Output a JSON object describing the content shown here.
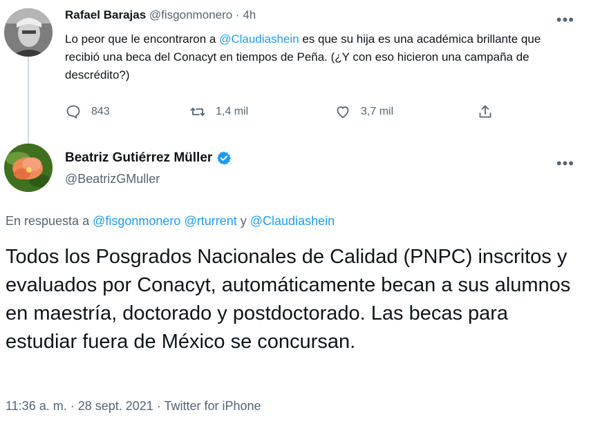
{
  "tweet1": {
    "name": "Rafael Barajas",
    "handle": "@fisgonmonero",
    "separator": "·",
    "time": "4h",
    "text_before": "Lo peor que le encontraron a ",
    "mention": "@Claudiashein",
    "text_after": " es que su hija es una académica brillante que recibió una beca del Conacyt en tiempos de Peña. (¿Y con eso hicieron una campaña de descrédito?)",
    "more_icon": "more-dots-icon",
    "actions": {
      "reply_count": "843",
      "retweet_count": "1,4 mil",
      "like_count": "3,7 mil"
    }
  },
  "tweet2": {
    "name": "Beatriz Gutiérrez Müller",
    "verified_icon": "verified-badge-icon",
    "handle": "@BeatrizGMuller",
    "reply_prefix": "En respuesta a ",
    "reply_mention_1": "@fisgonmonero",
    "reply_mention_2": "@rturrent",
    "reply_conjunction": " y ",
    "reply_mention_3": "@Claudiashein",
    "text": "Todos los Posgrados Nacionales de Calidad (PNPC) inscritos y evaluados por Conacyt, automáticamente becan a sus alumnos en maestría, doctorado y postdoctorado. Las becas para estudiar fuera de México se concursan.",
    "time": "11:36 a. m.",
    "date": "28 sept. 2021",
    "source": "Twitter for iPhone",
    "meta_sep": " · "
  },
  "colors": {
    "accent": "#1d9bf0",
    "secondary_text": "#536471",
    "primary_text": "#0f1419"
  }
}
